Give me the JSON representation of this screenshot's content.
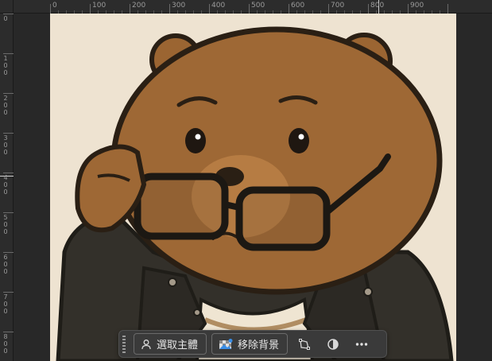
{
  "ruler_top": {
    "labels": [
      "0",
      "100",
      "200",
      "300",
      "400",
      "500",
      "600",
      "700",
      "800",
      "900"
    ]
  },
  "ruler_left": {
    "labels": [
      "0",
      "1 0 0",
      "2 0 0",
      "3 0 0",
      "4 0 0",
      "5 0 0",
      "6 0 0",
      "7 0 0",
      "8 0 0"
    ]
  },
  "canvas": {
    "image_description_icon": "bear-illustration",
    "background_color": "#eee3d1"
  },
  "toolbar": {
    "select_subject_label": "選取主體",
    "remove_background_label": "移除背景",
    "icons": [
      "person-select-icon",
      "remove-bg-icon",
      "transform-icon",
      "contrast-icon",
      "more-icon"
    ]
  }
}
